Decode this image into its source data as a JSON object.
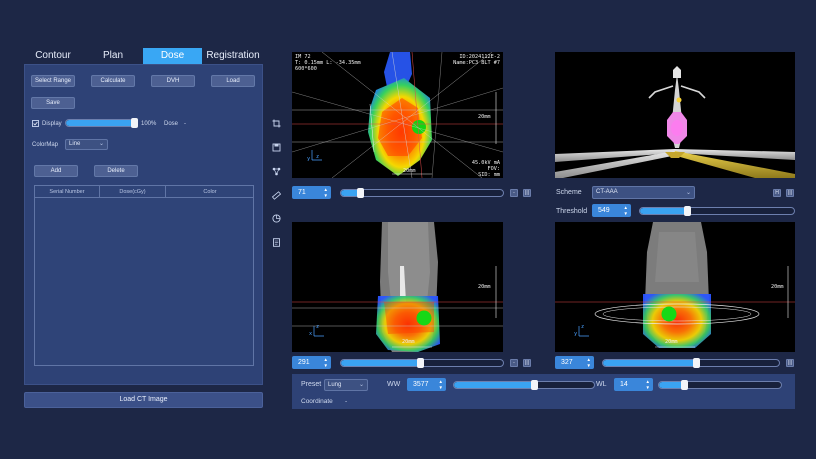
{
  "tabs": [
    {
      "label": "Contour",
      "active": false
    },
    {
      "label": "Plan",
      "active": false
    },
    {
      "label": "Dose",
      "active": true
    },
    {
      "label": "Registration",
      "active": false
    }
  ],
  "dose_panel": {
    "select_range": "Select Range",
    "calculate": "Calculate",
    "dvh": "DVH",
    "load": "Load",
    "save": "Save",
    "display_label": "Display",
    "display_checked": true,
    "display_percent": "100%",
    "display_value": 1.0,
    "dose_label": "Dose",
    "dose_value": "-",
    "colormap_label": "ColorMap",
    "colormap_value": "Line",
    "add": "Add",
    "delete": "Delete",
    "columns": [
      "Serial Number",
      "Dose(cGy)",
      "Color"
    ]
  },
  "load_ct": "Load CT Image",
  "tools": [
    "crop-icon",
    "save-icon",
    "network-icon",
    "ruler-icon",
    "palette-icon",
    "document-icon"
  ],
  "axial_view": {
    "info_tl": [
      "IM 72",
      "T: 0.15mm L: -34.35mm",
      "600*600"
    ],
    "info_tr": [
      "ID:2024112E-2",
      "Name:PC3 BLT #7"
    ],
    "info_br": [
      "45.0kV mA",
      "FOV:",
      "SID: mm"
    ],
    "scale_right": "20mm",
    "scale_bottom": "20mm",
    "slice": "71",
    "slider": 0.12
  },
  "render3d": {
    "scheme_label": "Scheme",
    "scheme_value": "CT-AAA",
    "threshold_label": "Threshold",
    "threshold_value": "549",
    "slider": 0.31
  },
  "coronal_view": {
    "scale_right": "20mm",
    "scale_bottom": "20mm",
    "slice": "291",
    "slider": 0.49
  },
  "sagittal_view": {
    "scale_right": "20mm",
    "scale_bottom": "20mm",
    "slice": "327",
    "slider": 0.53
  },
  "window": {
    "preset_label": "Preset",
    "preset_value": "Lung",
    "ww_label": "WW",
    "ww_value": "3577",
    "ww_slider": 0.57,
    "wl_label": "WL",
    "wl_value": "14",
    "wl_slider": 0.21,
    "coordinate_label": "Coordinate",
    "coordinate_value": "-"
  },
  "axes": {
    "z": "z",
    "y": "y",
    "x": "x"
  },
  "colors": {
    "accent": "#39a7f4",
    "panel": "#2e4276",
    "background": "#1d2746"
  }
}
